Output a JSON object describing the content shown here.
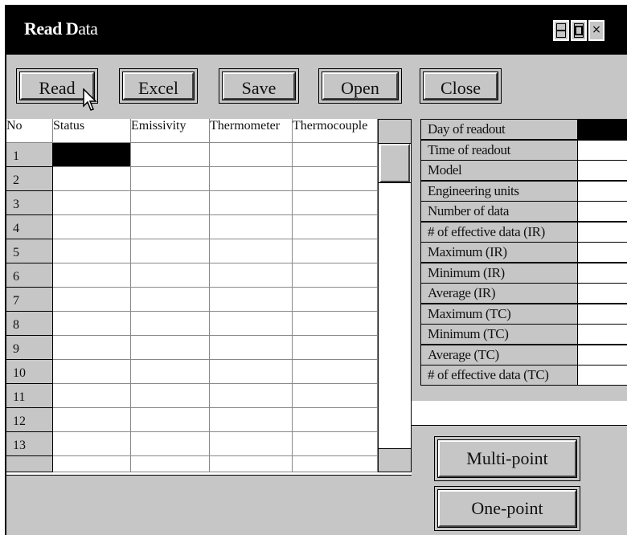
{
  "window": {
    "title_bold": "Read D",
    "title_rest": "ata",
    "controls": [
      "minimize-icon",
      "maximize-icon",
      "close-icon"
    ],
    "close_glyph": "×"
  },
  "toolbar": {
    "buttons": [
      {
        "label": "Read"
      },
      {
        "label": "Excel"
      },
      {
        "label": "Save"
      },
      {
        "label": "Open"
      },
      {
        "label": "Close"
      }
    ]
  },
  "table": {
    "columns": [
      "No",
      "Status",
      "Emissivity",
      "Thermometer",
      "Thermocouple"
    ],
    "rows": [
      "1",
      "2",
      "3",
      "4",
      "5",
      "6",
      "7",
      "8",
      "9",
      "10",
      "11",
      "12",
      "13"
    ],
    "selected_cell": {
      "row": 0,
      "column": "Status"
    }
  },
  "info": {
    "fields": [
      {
        "label": "Day of readout",
        "value": ""
      },
      {
        "label": "Time of readout",
        "value": ""
      },
      {
        "label": "Model",
        "value": ""
      },
      {
        "label": "Engineering units",
        "value": ""
      },
      {
        "label": "Number of data",
        "value": ""
      },
      {
        "label": "# of effective data (IR)",
        "value": ""
      },
      {
        "label": "Maximum (IR)",
        "value": ""
      },
      {
        "label": "Minimum  (IR)",
        "value": ""
      },
      {
        "label": " Average (IR)",
        "value": ""
      },
      {
        "label": " Maximum (TC)",
        "value": ""
      },
      {
        "label": "Minimum (TC)",
        "value": ""
      },
      {
        "label": " Average  (TC)",
        "value": ""
      },
      {
        "label": "# of effective data (TC)",
        "value": ""
      }
    ]
  },
  "actions": {
    "multipoint_label": "Multi-point",
    "onepoint_label": "One-point"
  },
  "colors": {
    "titlebar": "#000000",
    "face": "#c6c6c6",
    "cell": "#ffffff"
  }
}
